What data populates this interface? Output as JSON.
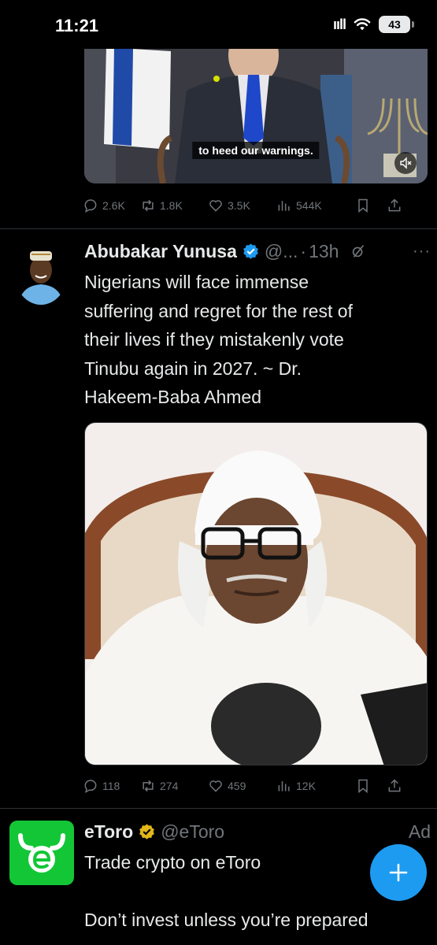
{
  "status_bar": {
    "time": "11:21",
    "battery": "43"
  },
  "tweet_prev": {
    "video_subtitle": "to heed our warnings.",
    "stats": {
      "replies": "2.6K",
      "reposts": "1.8K",
      "likes": "3.5K",
      "views": "544K"
    }
  },
  "tweet_main": {
    "author_name": "Abubakar Yunusa",
    "handle": "@...",
    "time": "13h",
    "text": "Nigerians will face immense\nsuffering and regret for the rest of\ntheir lives if they mistakenly vote\nTinubu again in 2027. ~ Dr.\nHakeem-Baba Ahmed",
    "stats": {
      "replies": "118",
      "reposts": "274",
      "likes": "459",
      "views": "12K"
    }
  },
  "ad_tweet": {
    "author_name": "eToro",
    "handle": "@eToro",
    "ad_label": "Ad",
    "text": "Trade crypto on eToro",
    "text2": "Don’t invest unless you’re prepared"
  },
  "colors": {
    "accent": "#1d9bf0",
    "muted": "#71767b",
    "etoro_green": "#13c636",
    "gold_badge": "#e2b719"
  },
  "icons": [
    "reply-icon",
    "repost-icon",
    "like-icon",
    "views-icon",
    "bookmark-icon",
    "share-icon",
    "verified-icon",
    "grok-icon",
    "more-icon",
    "mute-icon",
    "plus-icon"
  ]
}
